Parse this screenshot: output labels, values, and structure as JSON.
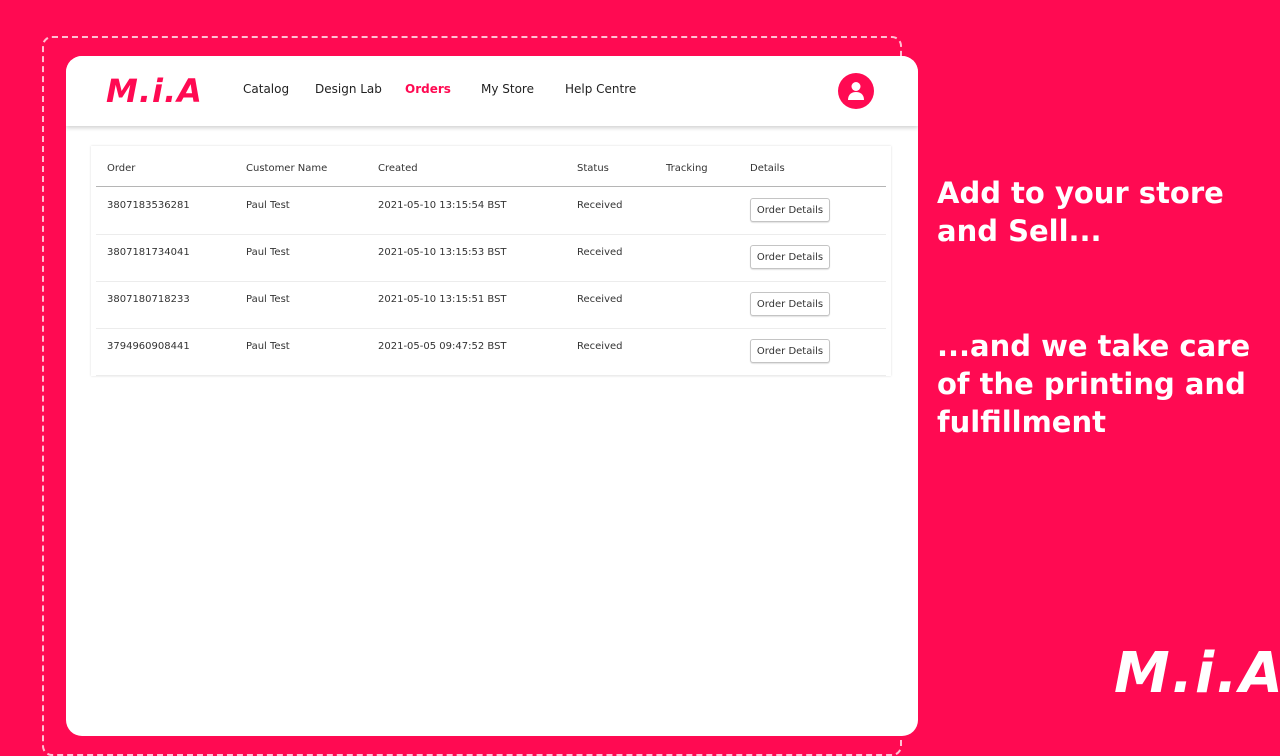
{
  "brand": {
    "logo_text": "M.i.A",
    "accent_color": "#ff0a52"
  },
  "nav": {
    "items": [
      {
        "label": "Catalog",
        "active": false
      },
      {
        "label": "Design Lab",
        "active": false
      },
      {
        "label": "Orders",
        "active": true
      },
      {
        "label": "My Store",
        "active": false
      },
      {
        "label": "Help Centre",
        "active": false
      }
    ],
    "avatar_icon": "user-icon"
  },
  "orders_table": {
    "columns": [
      "Order",
      "Customer Name",
      "Created",
      "Status",
      "Tracking",
      "Details"
    ],
    "rows": [
      {
        "order": "3807183536281",
        "customer": "Paul Test",
        "created": "2021-05-10 13:15:54 BST",
        "status": "Received",
        "tracking": "",
        "details_label": "Order Details"
      },
      {
        "order": "3807181734041",
        "customer": "Paul Test",
        "created": "2021-05-10 13:15:53 BST",
        "status": "Received",
        "tracking": "",
        "details_label": "Order Details"
      },
      {
        "order": "3807180718233",
        "customer": "Paul Test",
        "created": "2021-05-10 13:15:51 BST",
        "status": "Received",
        "tracking": "",
        "details_label": "Order Details"
      },
      {
        "order": "3794960908441",
        "customer": "Paul Test",
        "created": "2021-05-05 09:47:52 BST",
        "status": "Received",
        "tracking": "",
        "details_label": "Order Details"
      }
    ]
  },
  "promo": {
    "line1": "Add to your store and Sell...",
    "line2": "...and we take care of the printing and fulfillment",
    "logo_text": "M.i.A"
  }
}
